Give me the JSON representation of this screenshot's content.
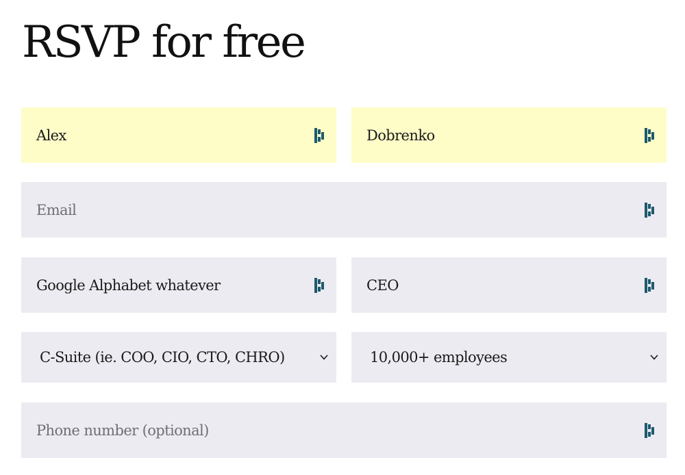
{
  "page": {
    "title": "RSVP for free"
  },
  "form": {
    "first_name": {
      "value": "Alex",
      "placeholder": ""
    },
    "last_name": {
      "value": "Dobrenko",
      "placeholder": ""
    },
    "email": {
      "value": "",
      "placeholder": "Email"
    },
    "company": {
      "value": "Google Alphabet whatever",
      "placeholder": ""
    },
    "job_title": {
      "value": "CEO",
      "placeholder": ""
    },
    "job_level": {
      "selected": "C-Suite (ie. COO, CIO, CTO, CHRO)"
    },
    "company_size": {
      "selected": "10,000+ employees"
    },
    "phone": {
      "value": "",
      "placeholder": "Phone number (optional)"
    }
  },
  "icons": {
    "field_extension": "password-manager-icon",
    "dropdown": "chevron-down-icon"
  },
  "colors": {
    "field_bg": "#ecebf1",
    "autofill_bg": "#fefdc8",
    "icon_teal": "#1d5a6e",
    "text": "#111111",
    "placeholder": "#6e6e78"
  }
}
